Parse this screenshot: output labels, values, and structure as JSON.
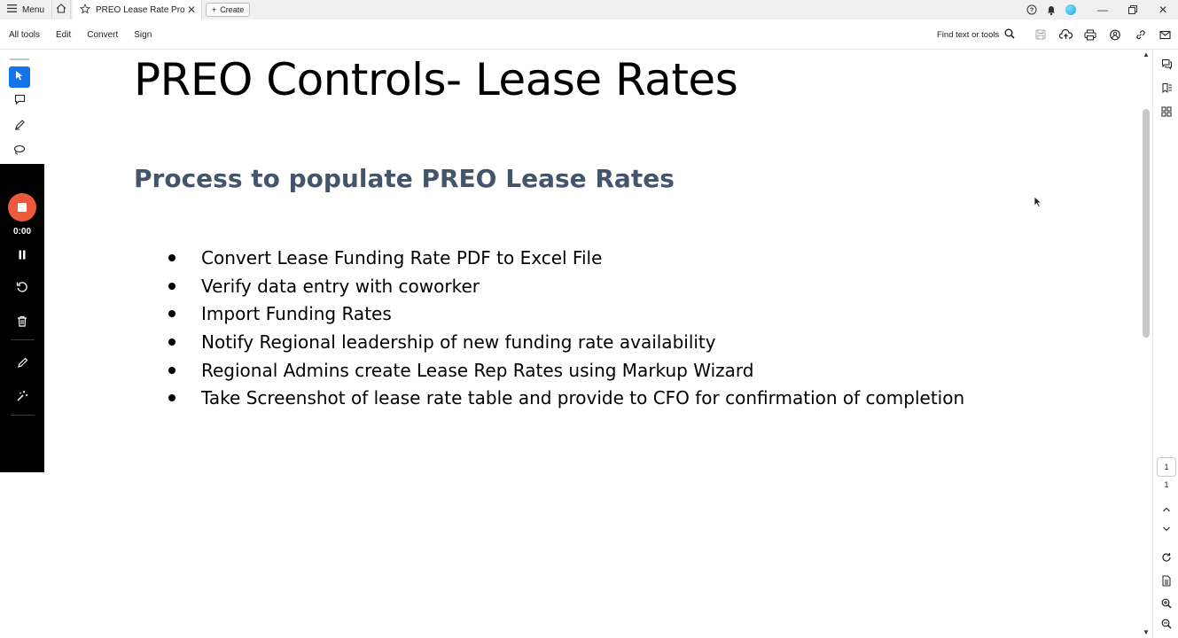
{
  "titlebar": {
    "menu_label": "Menu",
    "tab_title": "PREO Lease Rate Proce...",
    "create_label": "Create"
  },
  "menubar": {
    "items": [
      "All tools",
      "Edit",
      "Convert",
      "Sign"
    ],
    "find_label": "Find text or tools"
  },
  "recorder": {
    "time": "0:00"
  },
  "document": {
    "title": "PREO Controls- Lease Rates",
    "subtitle": "Process to populate PREO Lease Rates",
    "subtitle_color": "#44546a",
    "bullets": [
      "Convert Lease Funding Rate PDF to Excel File",
      "Verify data entry with coworker",
      "Import Funding Rates",
      "Notify Regional leadership of new funding rate availability",
      "Regional Admins create Lease Rep Rates using Markup Wizard",
      "Take Screenshot of lease rate table and provide to CFO for confirmation of completion"
    ]
  },
  "pagination": {
    "current": "1",
    "total": "1"
  },
  "colors": {
    "accent": "#1473e6",
    "record": "#ec5a3b"
  }
}
